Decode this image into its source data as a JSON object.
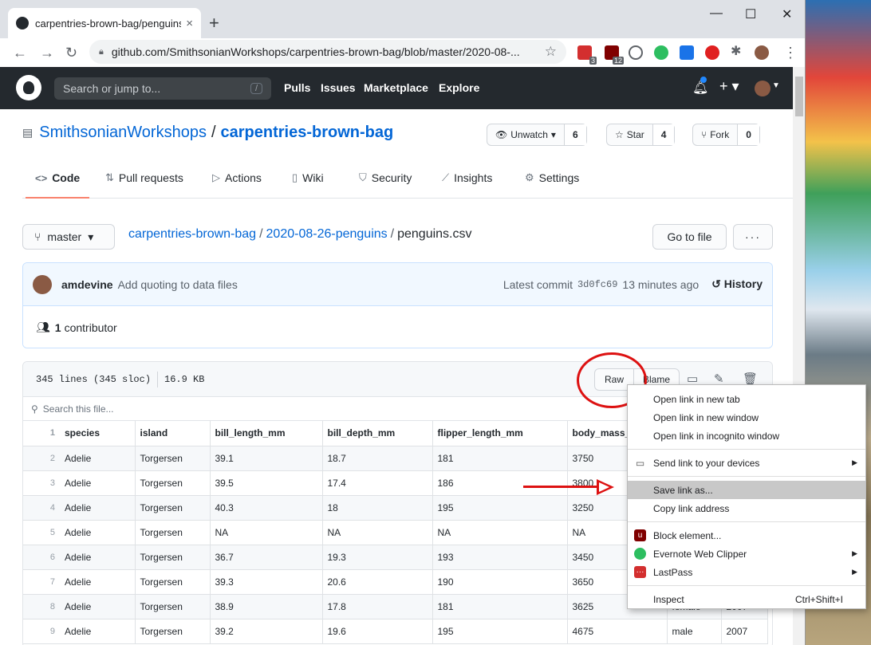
{
  "browser": {
    "tab_title": "carpentries-brown-bag/penguins",
    "tab_close": "×",
    "new_tab": "+",
    "url": "github.com/SmithsonianWorkshops/carpentries-brown-bag/blob/master/2020-08-...",
    "badges": [
      "3",
      "12"
    ]
  },
  "gh": {
    "search_placeholder": "Search or jump to...",
    "search_key": "/",
    "nav": [
      "Pulls",
      "Issues",
      "Marketplace",
      "Explore"
    ]
  },
  "repo": {
    "owner": "SmithsonianWorkshops",
    "sep": "/",
    "name": "carpentries-brown-bag",
    "unwatch_label": "Unwatch",
    "unwatch_count": "6",
    "star_label": "Star",
    "star_count": "4",
    "fork_label": "Fork",
    "fork_count": "0",
    "tabs": [
      "Code",
      "Pull requests",
      "Actions",
      "Wiki",
      "Security",
      "Insights",
      "Settings"
    ]
  },
  "file": {
    "branch": "master",
    "crumb_repo": "carpentries-brown-bag",
    "crumb_dir": "2020-08-26-penguins",
    "crumb_file": "penguins.csv",
    "goto_file": "Go to file",
    "more": "···",
    "commit_user": "amdevine",
    "commit_msg": "Add quoting to data files",
    "latest_commit": "Latest commit",
    "commit_sha": "3d0fc69",
    "commit_time": "13 minutes ago",
    "history": "History",
    "contributors_count": "1",
    "contributors_label": "contributor",
    "lines_info": "345 lines (345 sloc)",
    "size": "16.9 KB",
    "raw": "Raw",
    "blame": "Blame",
    "search_placeholder": "Search this file..."
  },
  "table": {
    "headers": [
      "species",
      "island",
      "bill_length_mm",
      "bill_depth_mm",
      "flipper_length_mm",
      "body_mass_"
    ],
    "rows": [
      {
        "n": "2",
        "c": [
          "Adelie",
          "Torgersen",
          "39.1",
          "18.7",
          "181",
          "3750"
        ]
      },
      {
        "n": "3",
        "c": [
          "Adelie",
          "Torgersen",
          "39.5",
          "17.4",
          "186",
          "3800"
        ]
      },
      {
        "n": "4",
        "c": [
          "Adelie",
          "Torgersen",
          "40.3",
          "18",
          "195",
          "3250"
        ]
      },
      {
        "n": "5",
        "c": [
          "Adelie",
          "Torgersen",
          "NA",
          "NA",
          "NA",
          "NA"
        ]
      },
      {
        "n": "6",
        "c": [
          "Adelie",
          "Torgersen",
          "36.7",
          "19.3",
          "193",
          "3450"
        ]
      },
      {
        "n": "7",
        "c": [
          "Adelie",
          "Torgersen",
          "39.3",
          "20.6",
          "190",
          "3650"
        ]
      },
      {
        "n": "8",
        "c": [
          "Adelie",
          "Torgersen",
          "38.9",
          "17.8",
          "181",
          "3625"
        ]
      },
      {
        "n": "9",
        "c": [
          "Adelie",
          "Torgersen",
          "39.2",
          "19.6",
          "195",
          "4675"
        ]
      }
    ],
    "extra_row8": [
      "female",
      "2007"
    ],
    "extra_row9": [
      "male",
      "2007"
    ]
  },
  "context_menu": {
    "items": [
      "Open link in new tab",
      "Open link in new window",
      "Open link in incognito window",
      "Send link to your devices",
      "Save link as...",
      "Copy link address",
      "Block element...",
      "Evernote Web Clipper",
      "LastPass",
      "Inspect"
    ],
    "inspect_shortcut": "Ctrl+Shift+I"
  }
}
